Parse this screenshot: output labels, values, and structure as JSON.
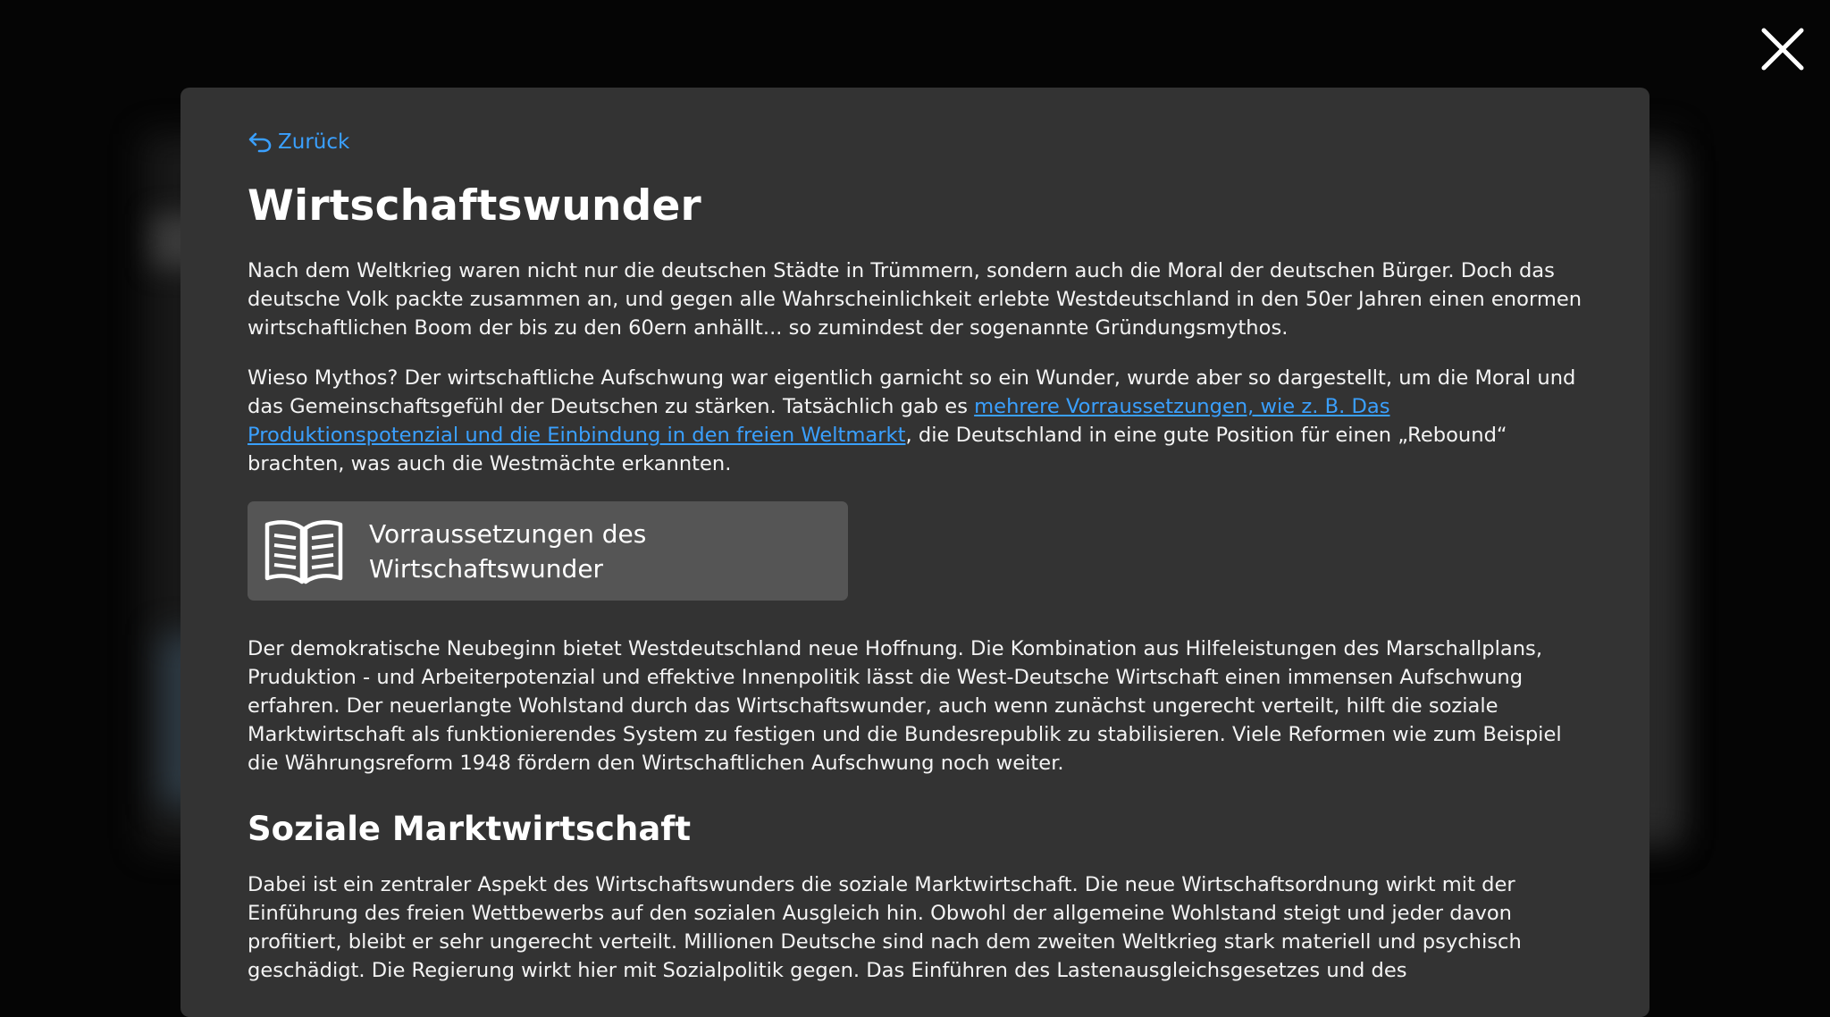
{
  "close": {
    "icon": "close-icon"
  },
  "modal": {
    "back_label": "Zurück",
    "title": "Wirtschaftswunder",
    "paragraph1": "Nach dem Weltkrieg waren nicht nur die deutschen Städte in Trümmern, sondern auch die Moral der deutschen Bürger. Doch das deutsche Volk packte zusammen an, und gegen alle Wahrscheinlichkeit erlebte Westdeutschland in den 50er Jahren einen enormen wirtschaftlichen Boom der bis zu den 60ern anhällt... so zumindest der sogenannte Gründungsmythos.",
    "paragraph2_before": "Wieso Mythos? Der wirtschaftliche Aufschwung war eigentlich garnicht so ein Wunder, wurde aber so dargestellt, um die Moral und das Gemeinschaftsgefühl der Deutschen zu stärken. Tatsächlich gab es ",
    "paragraph2_link": "mehrere Vorraussetzungen, wie z. B. Das Produktionspotenzial und die Einbindung in den freien Weltmarkt",
    "paragraph2_after": ", die Deutschland in eine gute Position für einen „Rebound“ brachten, was auch die Westmächte erkannten.",
    "card_label": "Vorraussetzungen des Wirtschaftswunder",
    "paragraph3": "Der demokratische Neubeginn bietet Westdeutschland neue Hoffnung. Die Kombination aus Hilfeleistungen des Marschallplans, Pruduktion - und Arbeiterpotenzial und effektive Innenpolitik lässt die West-Deutsche Wirtschaft einen immensen Aufschwung erfahren. Der neuerlangte Wohlstand durch das Wirtschaftswunder, auch wenn zunächst ungerecht verteilt, hilft die soziale Marktwirtschaft als funktionierendes System zu festigen und die Bundesrepublik zu stabilisieren. Viele Reformen wie zum Beispiel die Währungsreform 1948 fördern den Wirtschaftlichen Aufschwung noch weiter.",
    "subtitle": "Soziale Marktwirtschaft",
    "paragraph4": "Dabei ist ein zentraler Aspekt des Wirtschaftswunders die soziale Marktwirtschaft. Die neue Wirtschaftsordnung wirkt mit der Einführung des freien Wettbewerbs auf den sozialen Ausgleich hin. Obwohl der allgemeine Wohlstand steigt und jeder davon profitiert, bleibt er sehr ungerecht verteilt. Millionen Deutsche sind nach dem zweiten Weltkrieg stark materiell und psychisch geschädigt. Die Regierung wirkt hier mit Sozialpolitik gegen. Das Einführen des Lastenausgleichsgesetzes und des"
  },
  "icons": {
    "back": "undo-arrow-icon",
    "card": "open-book-icon"
  },
  "colors": {
    "link": "#3aa0ff",
    "modal_bg": "#333333",
    "card_bg": "#555555",
    "backdrop": "#050505"
  }
}
